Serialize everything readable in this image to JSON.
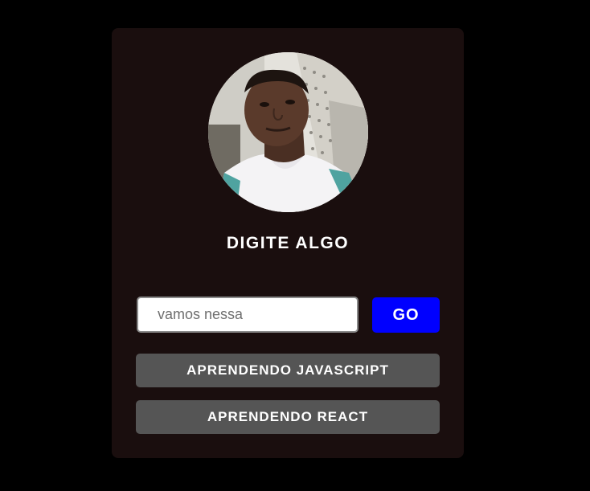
{
  "profile": {
    "avatar_alt": "profile-photo"
  },
  "header": {
    "title": "DIGITE ALGO"
  },
  "form": {
    "input_value": "vamos nessa",
    "go_label": "GO"
  },
  "list": {
    "items": [
      {
        "label": "APRENDENDO JAVASCRIPT"
      },
      {
        "label": "APRENDENDO REACT"
      }
    ]
  },
  "colors": {
    "background": "#000000",
    "card": "#1a0e0e",
    "go_button": "#0000ff",
    "list_button": "#555555",
    "text": "#ffffff"
  }
}
